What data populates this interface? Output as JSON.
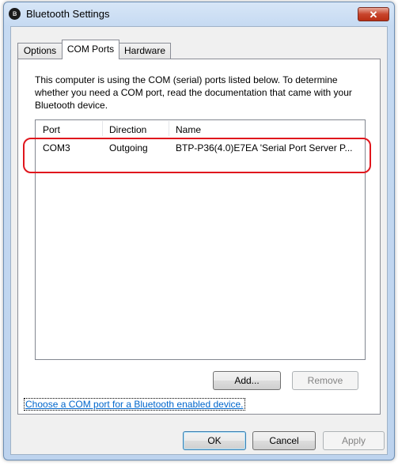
{
  "window": {
    "title": "Bluetooth Settings",
    "close_glyph": "✕",
    "app_icon": "bluetooth-icon",
    "bt_glyph": "ʙ"
  },
  "tabs": [
    {
      "label": "Options"
    },
    {
      "label": "COM Ports"
    },
    {
      "label": "Hardware"
    }
  ],
  "description": "This computer is using the COM (serial) ports listed below. To determine whether you need a COM port, read the documentation that came with your Bluetooth device.",
  "ports_table": {
    "columns": [
      "Port",
      "Direction",
      "Name"
    ],
    "rows": [
      {
        "port": "COM3",
        "direction": "Outgoing",
        "name": "BTP-P36(4.0)E7EA 'Serial Port Server P..."
      }
    ]
  },
  "buttons": {
    "add": "Add...",
    "remove": "Remove",
    "ok": "OK",
    "cancel": "Cancel",
    "apply": "Apply"
  },
  "link": "Choose a COM port for a Bluetooth enabled device.",
  "colors": {
    "highlight": "#e0161d",
    "link": "#0066cc",
    "close_button": "#c8442b"
  }
}
